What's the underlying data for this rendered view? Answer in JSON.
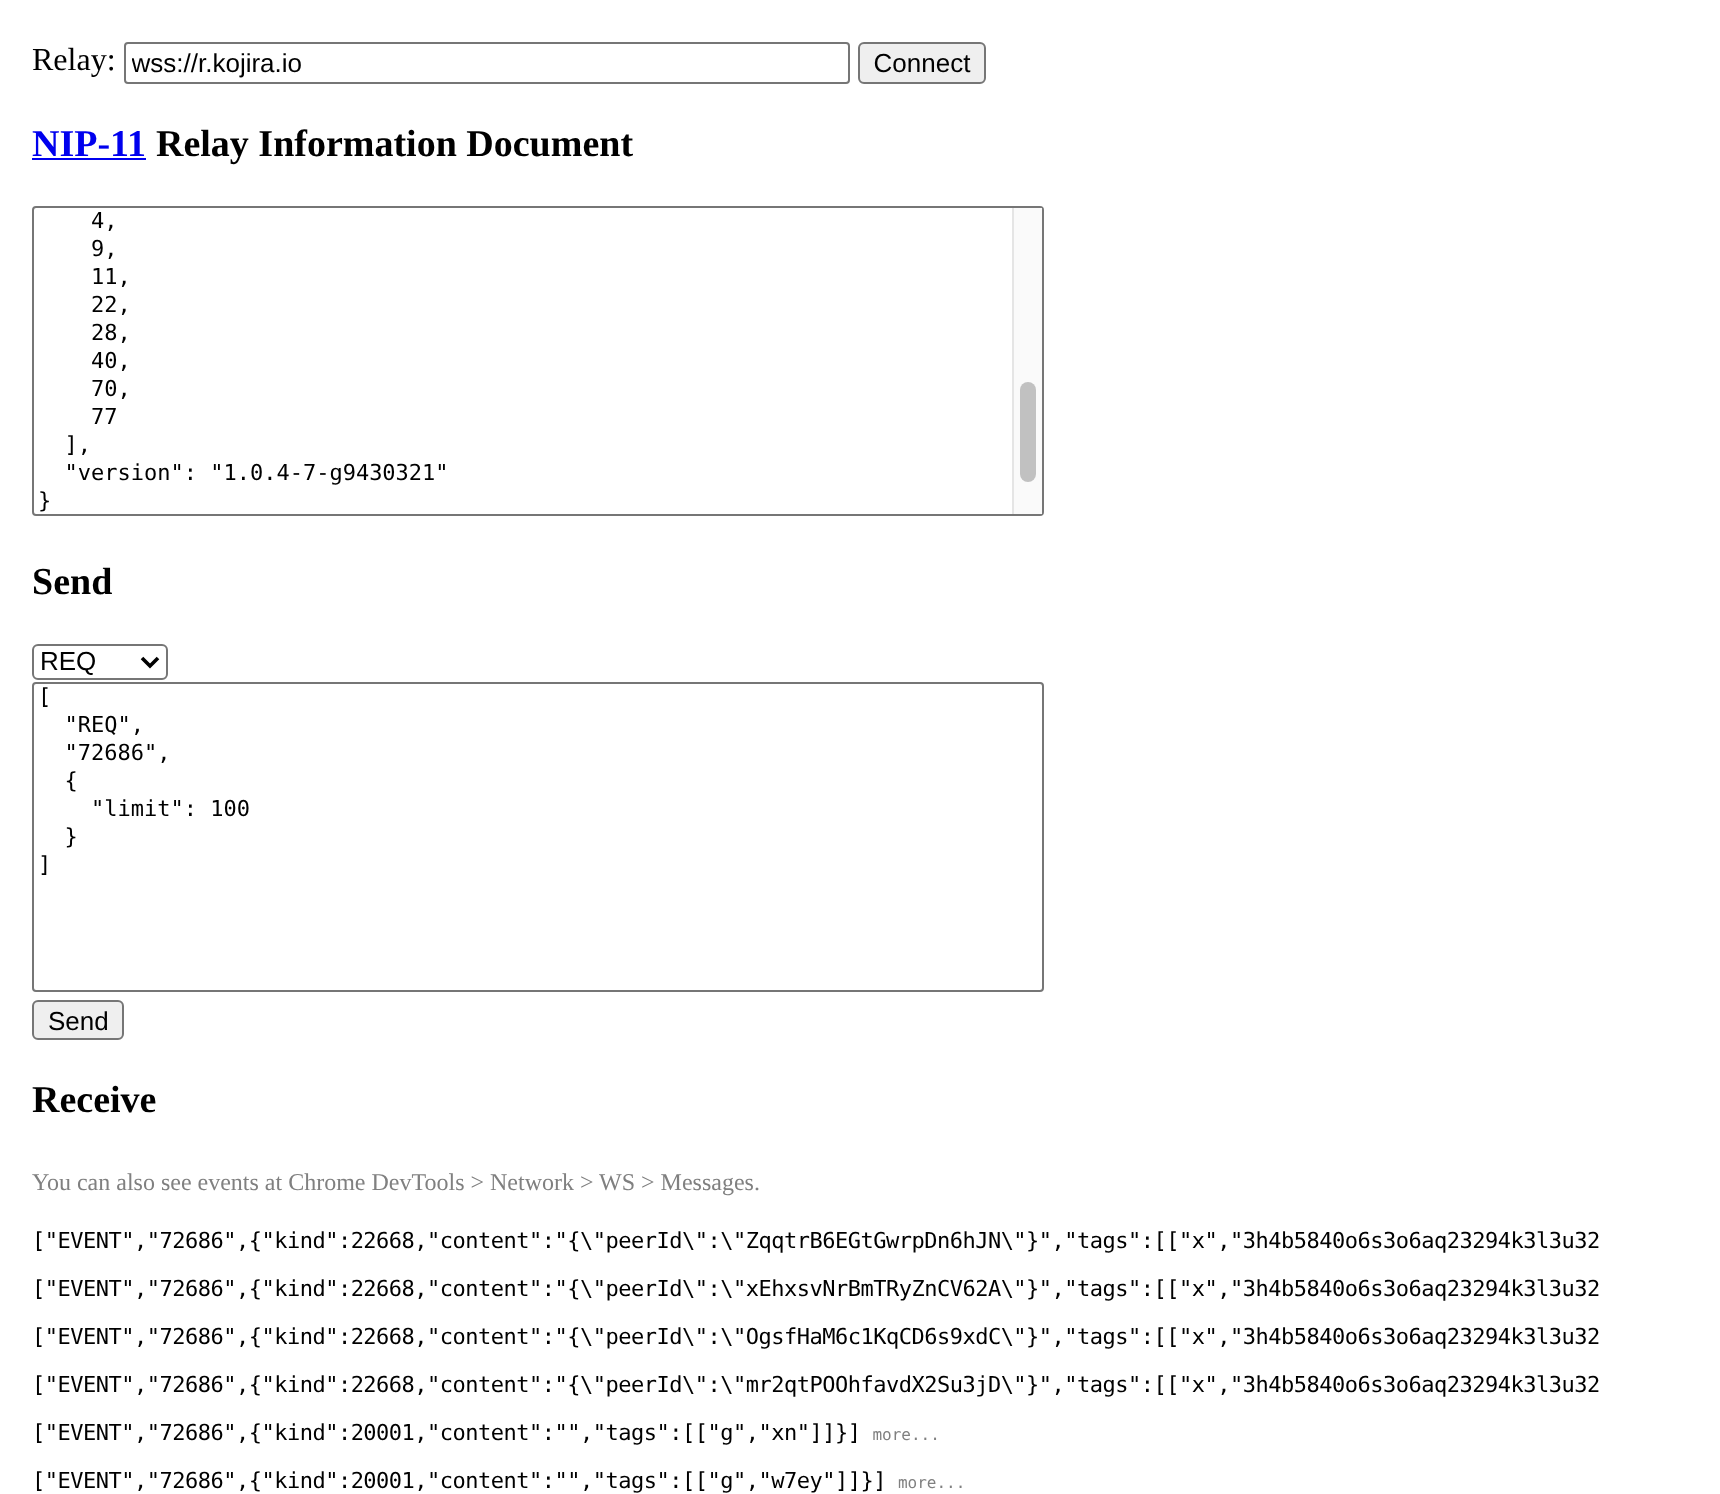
{
  "relay": {
    "label": "Relay:",
    "value": "wss://r.kojira.io",
    "connect_button": "Connect"
  },
  "info": {
    "link": "NIP-11",
    "title": "Relay Information Document",
    "document": "    4,\n    9,\n    11,\n    22,\n    28,\n    40,\n    70,\n    77\n  ],\n  \"version\": \"1.0.4-7-g9430321\"\n}"
  },
  "send": {
    "heading": "Send",
    "type_select": "REQ",
    "message": "[\n  \"REQ\",\n  \"72686\",\n  {\n    \"limit\": 100\n  }\n]",
    "send_button": "Send"
  },
  "receive": {
    "heading": "Receive",
    "hint": "You can also see events at Chrome DevTools > Network > WS > Messages.",
    "events": [
      {
        "text": "[\"EVENT\",\"72686\",{\"kind\":22668,\"content\":\"{\\\"peerId\\\":\\\"ZqqtrB6EGtGwrpDn6hJN\\\"}\",\"tags\":[[\"x\",\"3h4b5840o6s3o6aq23294k3l3u32"
      },
      {
        "text": "[\"EVENT\",\"72686\",{\"kind\":22668,\"content\":\"{\\\"peerId\\\":\\\"xEhxsvNrBmTRyZnCV62A\\\"}\",\"tags\":[[\"x\",\"3h4b5840o6s3o6aq23294k3l3u32"
      },
      {
        "text": "[\"EVENT\",\"72686\",{\"kind\":22668,\"content\":\"{\\\"peerId\\\":\\\"OgsfHaM6c1KqCD6s9xdC\\\"}\",\"tags\":[[\"x\",\"3h4b5840o6s3o6aq23294k3l3u32"
      },
      {
        "text": "[\"EVENT\",\"72686\",{\"kind\":22668,\"content\":\"{\\\"peerId\\\":\\\"mr2qtPOOhfavdX2Su3jD\\\"}\",\"tags\":[[\"x\",\"3h4b5840o6s3o6aq23294k3l3u32"
      },
      {
        "text": "[\"EVENT\",\"72686\",{\"kind\":20001,\"content\":\"\",\"tags\":[[\"g\",\"xn\"]]}]",
        "more": "more..."
      },
      {
        "text": "[\"EVENT\",\"72686\",{\"kind\":20001,\"content\":\"\",\"tags\":[[\"g\",\"w7ey\"]]}]",
        "more": "more..."
      }
    ]
  }
}
